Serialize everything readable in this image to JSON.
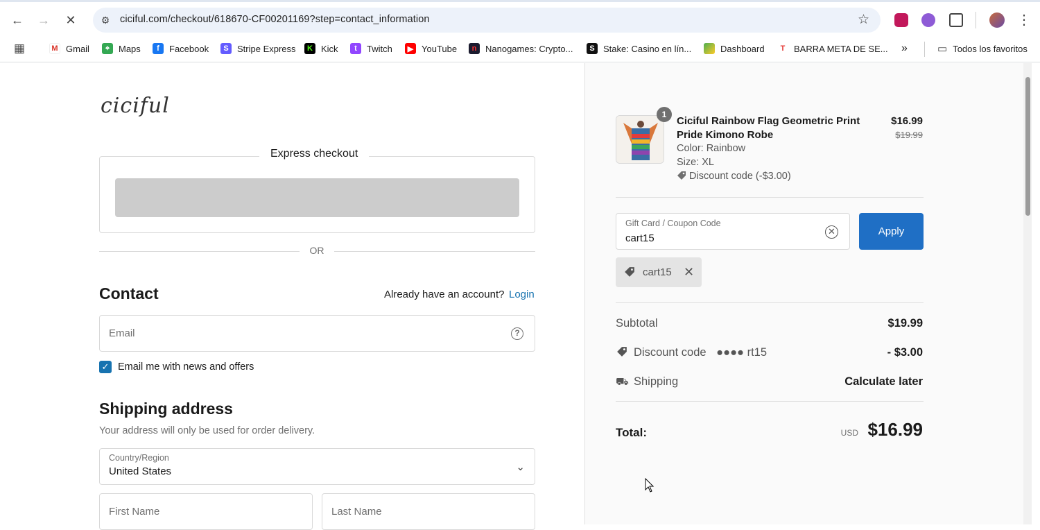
{
  "browser": {
    "url": "ciciful.com/checkout/618670-CF00201169?step=contact_information",
    "bookmarks": [
      "Gmail",
      "Maps",
      "Facebook",
      "Stripe Express",
      "Kick",
      "Twitch",
      "YouTube",
      "Nanogames: Crypto...",
      "Stake: Casino en lín...",
      "Dashboard",
      "BARRA META DE SE..."
    ],
    "more": "»",
    "all_bookmarks": "Todos los favoritos"
  },
  "checkout": {
    "logo": "ciciful",
    "express_title": "Express checkout",
    "or": "OR",
    "contact_heading": "Contact",
    "have_account": "Already have an account?",
    "login": "Login",
    "email_placeholder": "Email",
    "newsletter_label": "Email me with news and offers",
    "newsletter_checked": true,
    "shipping_heading": "Shipping address",
    "shipping_sub": "Your address will only be used for order delivery.",
    "country_label": "Country/Region",
    "country_value": "United States",
    "first_name_placeholder": "First Name",
    "last_name_placeholder": "Last Name"
  },
  "summary": {
    "quantity": "1",
    "product_name": "Ciciful Rainbow Flag Geometric Print Pride Kimono Robe",
    "price": "$16.99",
    "compare_price": "$19.99",
    "color": "Color: Rainbow",
    "size": "Size: XL",
    "discount_line": "Discount code (-$3.00)",
    "coupon_label": "Gift Card / Coupon Code",
    "coupon_value": "cart15",
    "apply": "Apply",
    "chip": "cart15",
    "subtotal_label": "Subtotal",
    "subtotal_value": "$19.99",
    "discount_label": "Discount code",
    "discount_code_masked": "●●●● rt15",
    "discount_value": "- $3.00",
    "shipping_label": "Shipping",
    "shipping_value": "Calculate later",
    "total_label": "Total:",
    "currency": "USD",
    "total_value": "$16.99"
  },
  "colors": {
    "accent": "#1773b0",
    "apply_button": "#1f6fc5",
    "express_button": "#cccccc"
  }
}
